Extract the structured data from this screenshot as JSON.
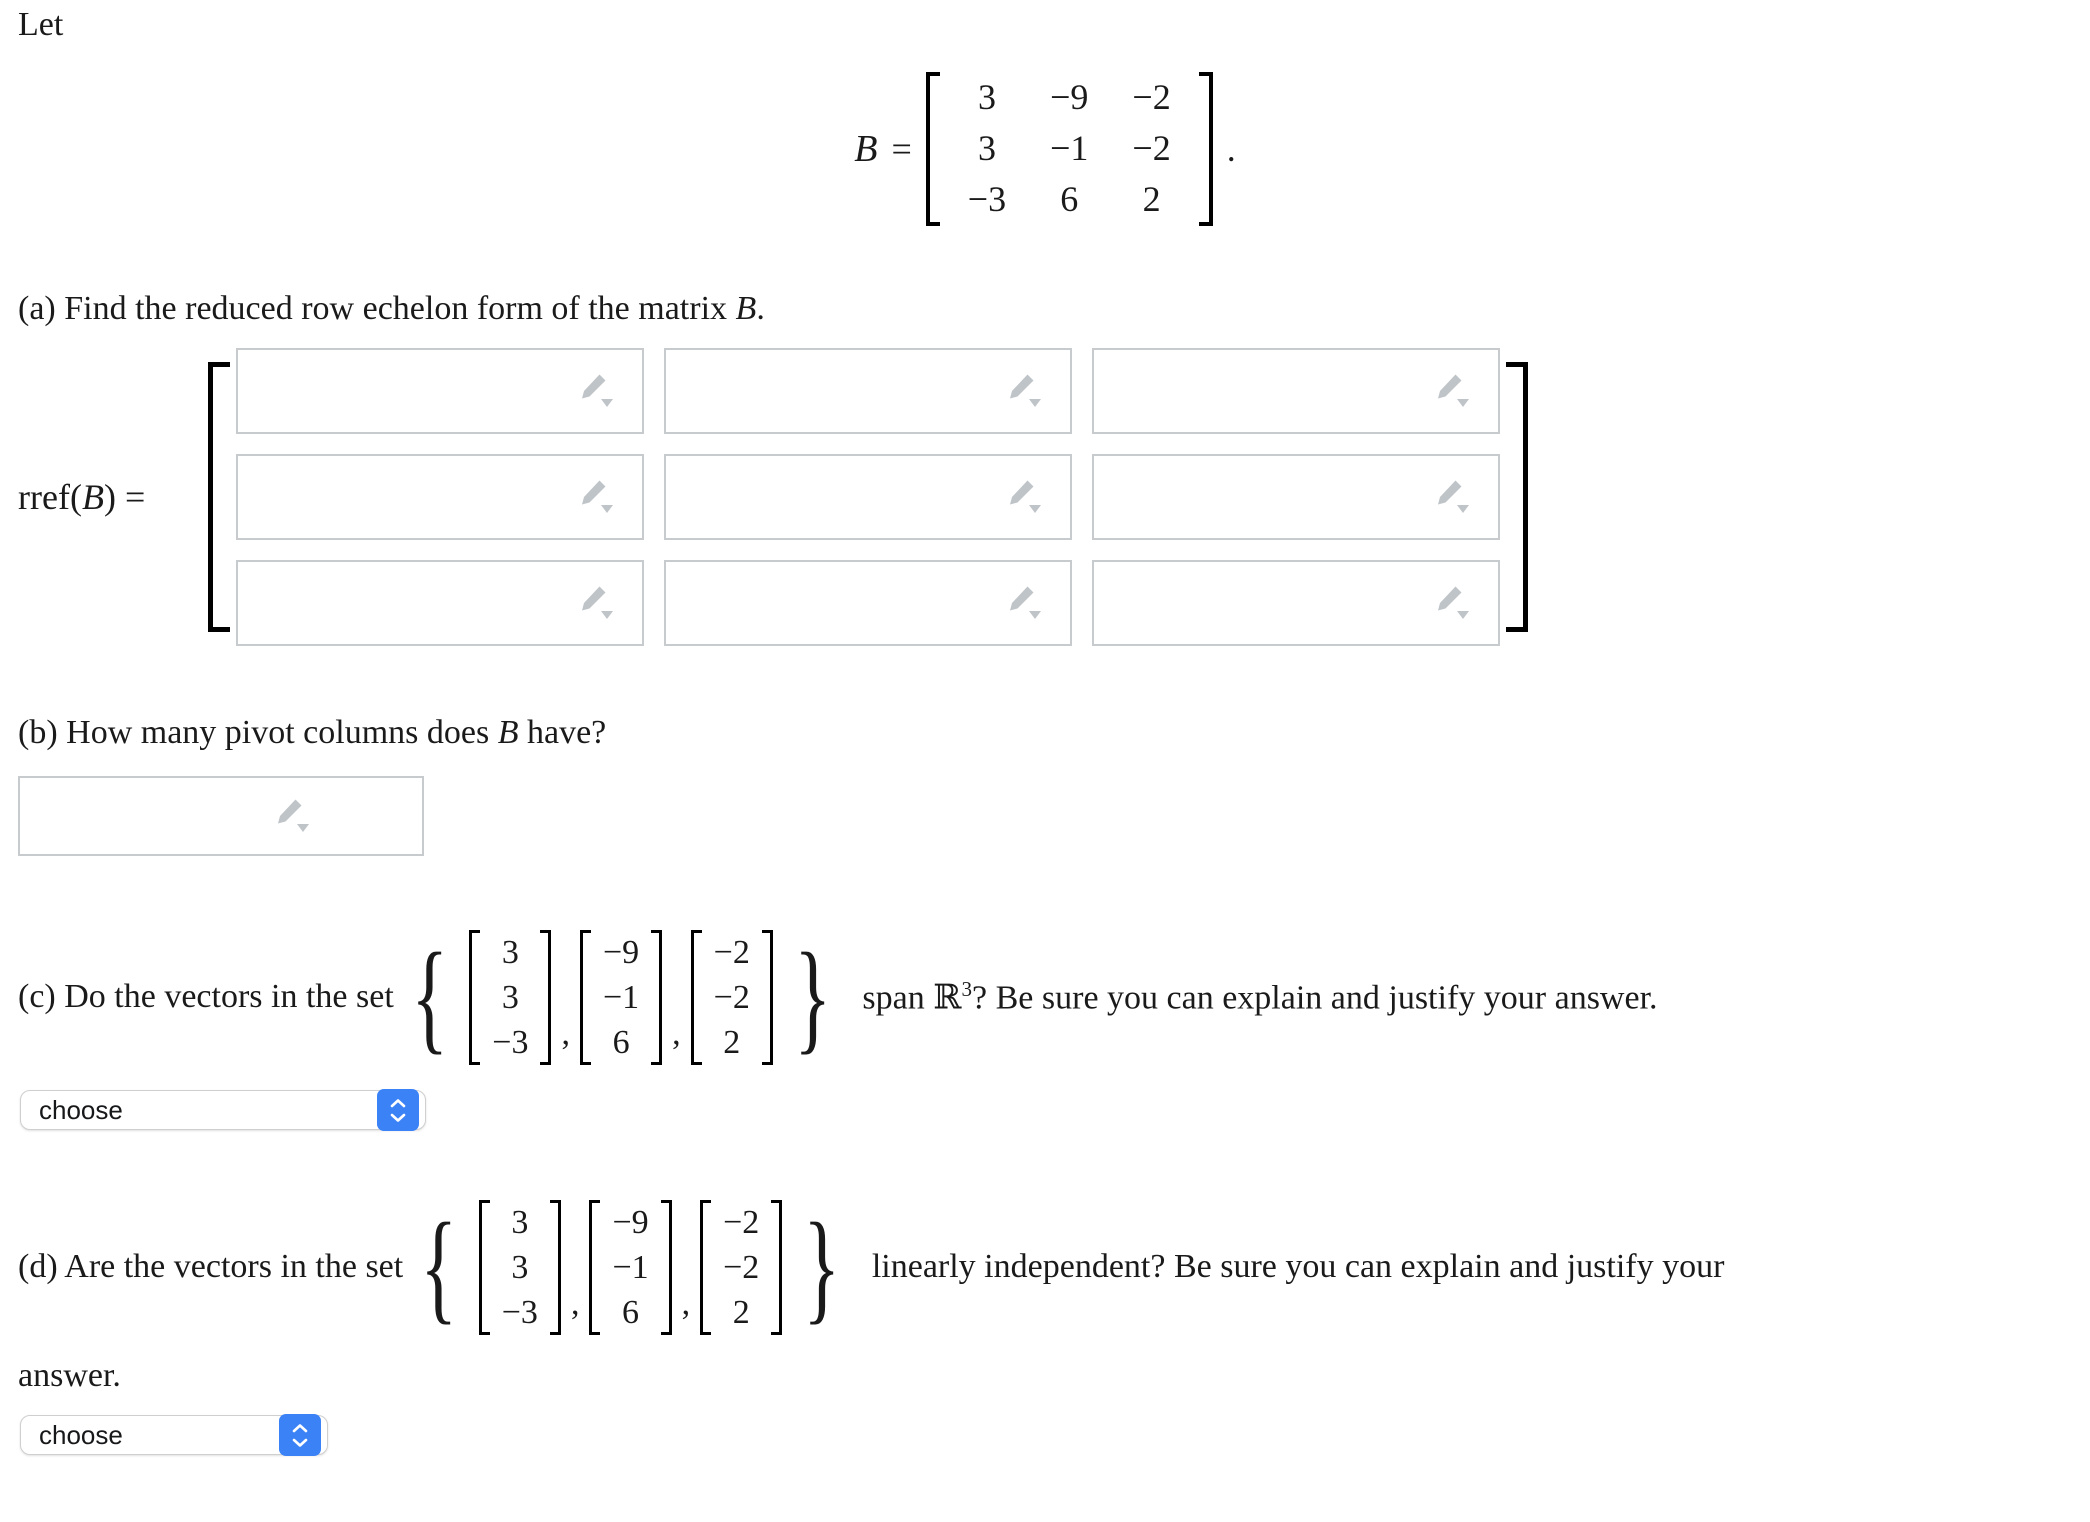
{
  "intro": {
    "let_text": "Let"
  },
  "matrix_b": {
    "label": "B",
    "equals": "=",
    "period": ".",
    "rows": [
      [
        "3",
        "−9",
        "−2"
      ],
      [
        "3",
        "−1",
        "−2"
      ],
      [
        "−3",
        "6",
        "2"
      ]
    ]
  },
  "part_a": {
    "prompt_prefix": "(a) Find the reduced row echelon form of the matrix ",
    "prompt_var": "B",
    "prompt_suffix": ".",
    "rref_label_fn": "rref",
    "rref_label_open": "(",
    "rref_label_var": "B",
    "rref_label_close": ")",
    "rref_label_eq": "=",
    "cells": [
      [
        "",
        "",
        ""
      ],
      [
        "",
        "",
        ""
      ],
      [
        "",
        "",
        ""
      ]
    ],
    "cell_icon": "pencil-dropdown-icon"
  },
  "part_b": {
    "prompt_prefix": "(b) How many pivot columns does ",
    "prompt_var": "B",
    "prompt_suffix": " have?",
    "answer_value": "",
    "answer_icon": "pencil-dropdown-icon"
  },
  "part_c": {
    "prompt_prefix": "(c) Do the vectors in the set ",
    "brace_open": "{",
    "brace_close": "}",
    "vectors": [
      [
        "3",
        "3",
        "−3"
      ],
      [
        "−9",
        "−1",
        "6"
      ],
      [
        "−2",
        "−2",
        "2"
      ]
    ],
    "separator": ",",
    "tail_pre": "span ",
    "tail_symbol": "ℝ",
    "tail_exponent": "3",
    "tail_post": "? Be sure you can explain and justify your answer.",
    "select": {
      "value": "choose",
      "stepper_icon": "chevron-up-down-icon",
      "accent_color": "#3b82f6"
    }
  },
  "part_d": {
    "prompt_prefix": "(d) Are the vectors in the set ",
    "brace_open": "{",
    "brace_close": "}",
    "vectors": [
      [
        "3",
        "3",
        "−3"
      ],
      [
        "−9",
        "−1",
        "6"
      ],
      [
        "−2",
        "−2",
        "2"
      ]
    ],
    "separator": ",",
    "tail_text": "linearly independent? Be sure you can explain and justify your",
    "answer_line": "answer.",
    "select": {
      "value": "choose",
      "stepper_icon": "chevron-up-down-icon",
      "accent_color": "#3b82f6"
    }
  }
}
